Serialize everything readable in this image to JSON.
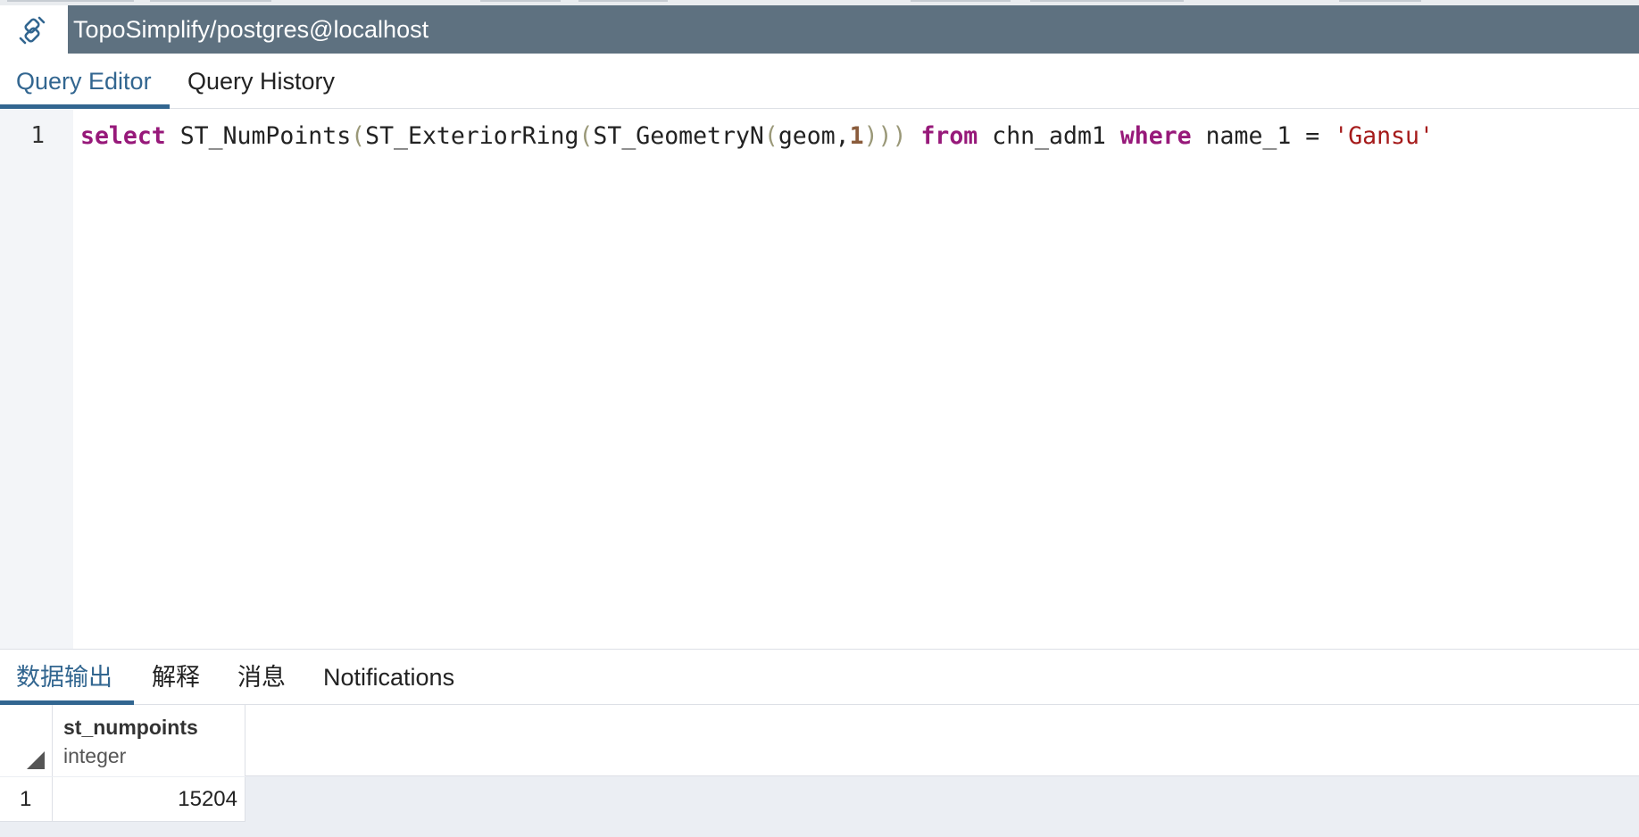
{
  "connection": {
    "title": "TopoSimplify/postgres@localhost",
    "icon": "connection-plug-icon",
    "bar_color": "#5e7180"
  },
  "editor_tabs": [
    {
      "label": "Query Editor",
      "active": true
    },
    {
      "label": "Query History",
      "active": false
    }
  ],
  "editor": {
    "line_number": "1",
    "tokens": {
      "select": "select",
      "fn1": "ST_NumPoints",
      "p1": "(",
      "fn2": "ST_ExteriorRing",
      "p2": "(",
      "fn3": "ST_GeometryN",
      "p3": "(",
      "arg1": "geom,",
      "num": "1",
      "p4": ")))",
      "from": "from",
      "table": "chn_adm1",
      "where": "where",
      "col": "name_1",
      "eq": "=",
      "str": "'Gansu'"
    }
  },
  "result_tabs": [
    {
      "label": "数据输出",
      "active": true
    },
    {
      "label": "解释",
      "active": false
    },
    {
      "label": "消息",
      "active": false
    },
    {
      "label": "Notifications",
      "active": false
    }
  ],
  "grid": {
    "columns": [
      {
        "name": "st_numpoints",
        "type": "integer"
      }
    ],
    "rows": [
      {
        "num": "1",
        "values": [
          "15204"
        ]
      }
    ]
  },
  "colors": {
    "accent": "#326690",
    "keyword": "#97197a",
    "string": "#a51a1a",
    "number": "#8a5c3c",
    "paren": "#9a9878"
  }
}
